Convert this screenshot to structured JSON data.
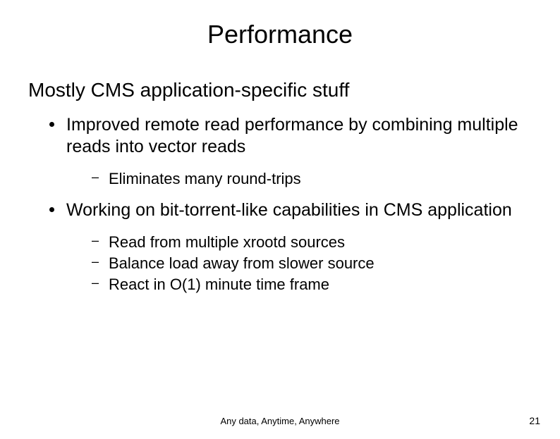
{
  "title": "Performance",
  "subtitle": "Mostly CMS application-specific stuff",
  "bullets": [
    {
      "text": "Improved remote read performance by combining multiple reads into vector reads",
      "sub": [
        "Eliminates many round-trips"
      ]
    },
    {
      "text": "Working on bit-torrent-like capabilities in CMS application",
      "sub": [
        "Read from multiple xrootd sources",
        "Balance load away from slower source",
        "React in O(1) minute time frame"
      ]
    }
  ],
  "footer": "Any data, Anytime, Anywhere",
  "page_number": "21"
}
